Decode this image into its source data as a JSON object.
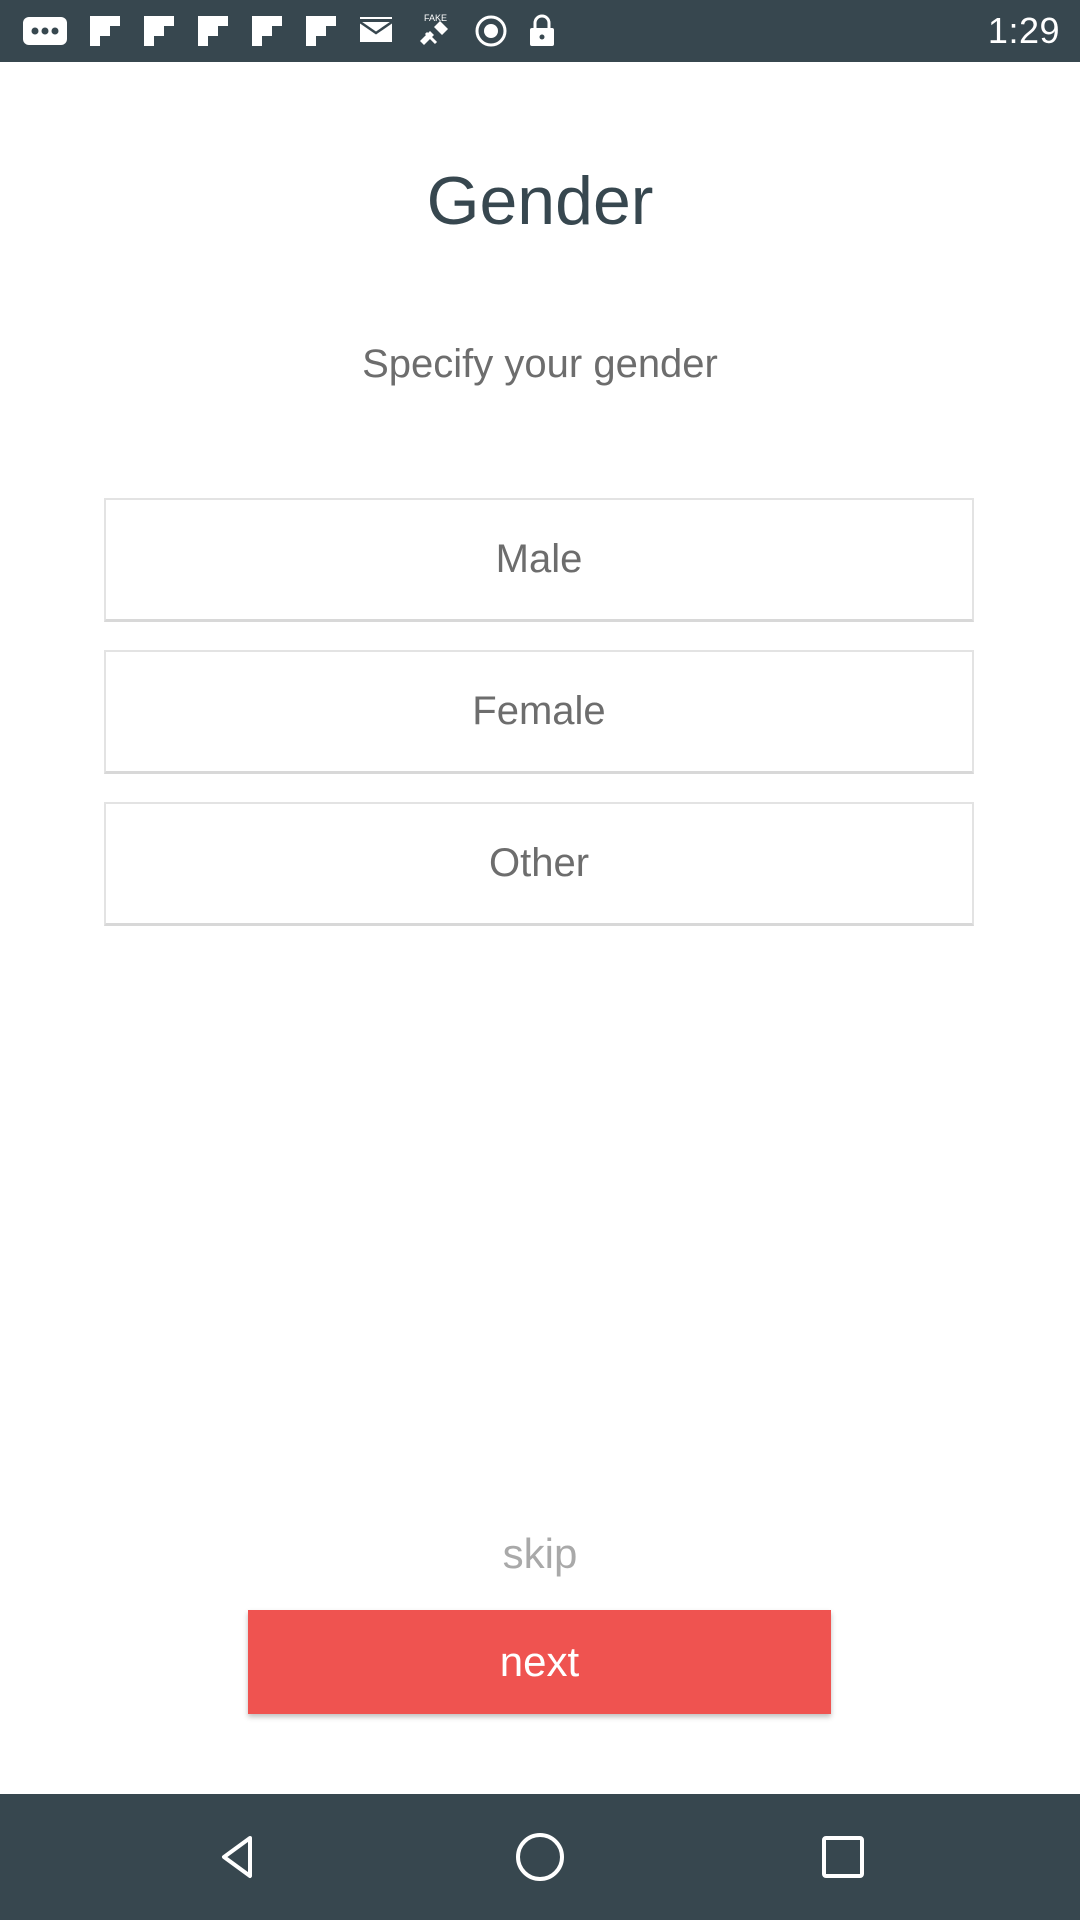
{
  "status_bar": {
    "time": "1:29",
    "left_icons": [
      "more-notifications-icon",
      "flipboard-icon",
      "flipboard-icon",
      "flipboard-icon",
      "flipboard-icon",
      "flipboard-icon",
      "mail-icon",
      "fake-gps-icon",
      "record-icon",
      "lock-icon"
    ],
    "right_icons": [
      "bluetooth-icon",
      "wifi-icon",
      "signal-icon",
      "battery-icon"
    ]
  },
  "page": {
    "title": "Gender",
    "subtitle": "Specify your gender",
    "options": [
      {
        "label": "Male"
      },
      {
        "label": "Female"
      },
      {
        "label": "Other"
      }
    ],
    "skip_label": "skip",
    "next_label": "next"
  },
  "colors": {
    "status_bar_bg": "#37474f",
    "accent": "#ef5350",
    "title_text": "#37474f",
    "body_text": "#6d6d6d"
  },
  "nav_bar": {
    "buttons": [
      "back-icon",
      "home-icon",
      "recent-apps-icon"
    ]
  }
}
